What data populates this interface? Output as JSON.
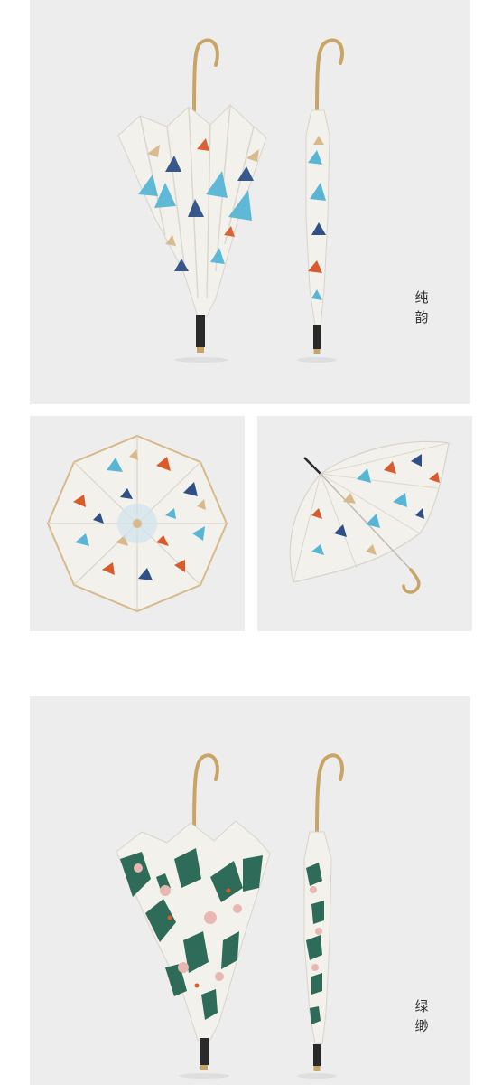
{
  "colors": {
    "background": "#ffffff",
    "panel": "#ededed",
    "handle_gold": "#c9a565",
    "canopy_white": "#f3f1ec",
    "leaf_blue": "#58b6d4",
    "leaf_navy": "#2f4f86",
    "leaf_orange": "#d95a2a",
    "leaf_tan": "#d7b98c",
    "green_print": "#2e6b58",
    "pink_print": "#e9b7b1"
  },
  "sections": [
    {
      "id": "chunyun",
      "name_lines": [
        "纯",
        "韵"
      ],
      "views": [
        "closed-front-icon",
        "rolled-side-icon"
      ]
    },
    {
      "id": "detail-views",
      "views": [
        "open-top-view-icon",
        "open-side-view-icon"
      ]
    },
    {
      "id": "lvyou",
      "name_lines": [
        "绿",
        "缈"
      ],
      "views": [
        "closed-front-icon",
        "rolled-side-icon"
      ]
    }
  ]
}
